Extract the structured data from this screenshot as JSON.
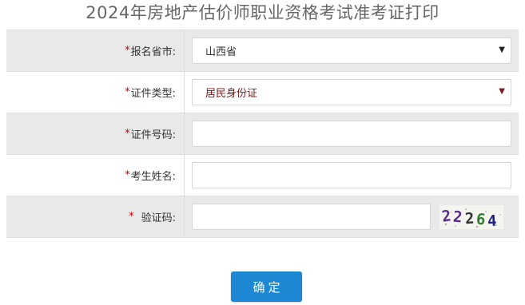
{
  "page": {
    "title": "2024年房地产估价师职业资格考试准考证打印"
  },
  "form": {
    "required_mark": "*",
    "rows": [
      {
        "label": "报名省市:",
        "value": "山西省"
      },
      {
        "label": "证件类型:",
        "value": "居民身份证"
      },
      {
        "label": "证件号码:",
        "value": ""
      },
      {
        "label": "考生姓名:",
        "value": ""
      },
      {
        "label": "验证码:",
        "value": ""
      }
    ],
    "captcha_text": "22264",
    "captcha_chars": [
      "2",
      "2",
      "2",
      "6",
      "4"
    ],
    "captcha_colors": [
      "#5b2c8a",
      "#5b2c8a",
      "#333333",
      "#2e7d32",
      "#1a237e"
    ]
  },
  "submit_label": "确定",
  "colors": {
    "accent_button": "#1c88d4",
    "required": "#d60000",
    "row_gray": "#e9e9e9"
  }
}
